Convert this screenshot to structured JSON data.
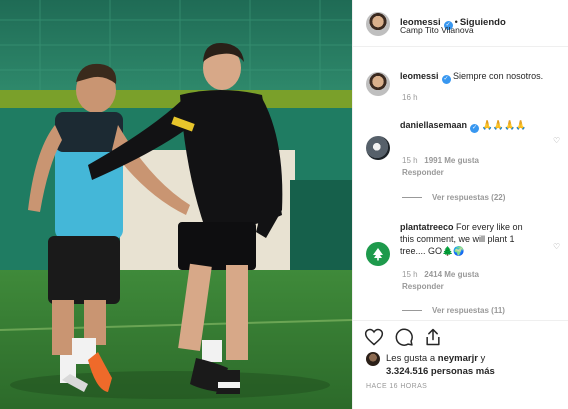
{
  "post": {
    "username": "leomessi",
    "follow_label": "Siguiendo",
    "location": "Camp Tito Vilanova"
  },
  "caption": {
    "username": "leomessi",
    "text": "Siempre con nosotros.",
    "time": "16 h"
  },
  "comments": [
    {
      "username": "daniellasemaan",
      "text": "🙏🙏🙏🙏",
      "time": "15 h",
      "likes": "1991 Me gusta",
      "reply_label": "Responder",
      "view_replies": "Ver respuestas (22)"
    },
    {
      "username": "plantatreeco",
      "text": "For every like on this comment, we will plant 1 tree.... GO🌲🌍",
      "text_line1": "For every like on",
      "text_line2": "this comment, we will plant 1",
      "text_line3": "tree.... GO🌲🌍",
      "time": "15 h",
      "likes": "2414 Me gusta",
      "reply_label": "Responder",
      "view_replies": "Ver respuestas (11)"
    }
  ],
  "likes": {
    "prefix": "Les gusta a",
    "user": "neymarjr",
    "connector": "y",
    "count": "3.324.516",
    "suffix": "personas más"
  },
  "time_ago": "HACE 16 HORAS",
  "icons": [
    "verified-badge-icon",
    "heart-icon",
    "comment-icon",
    "share-icon",
    "bookmark-icon",
    "options-icon"
  ],
  "colors": {
    "verified": "#3897f0",
    "muted": "#999999",
    "text": "#262626",
    "tree_logo": "#1e9a4c"
  }
}
